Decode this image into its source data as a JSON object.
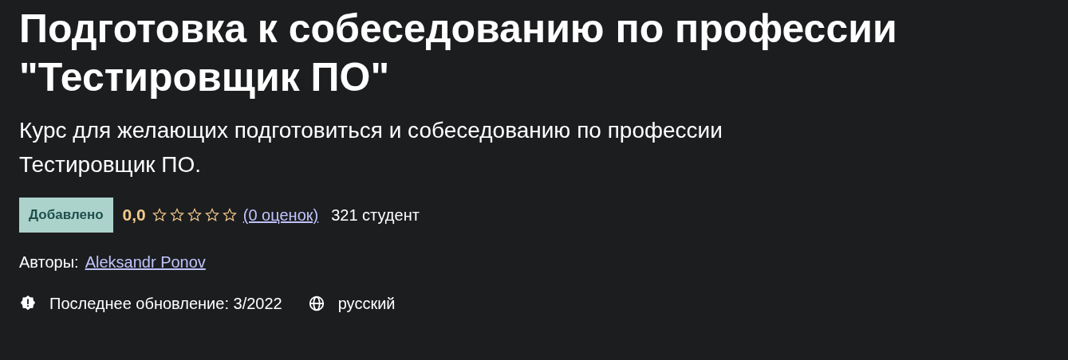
{
  "title": "Подготовка к собеседованию по профессии \"Тестировщик ПО\"",
  "subtitle": "Курс для желающих подготовиться и собеседованию по профессии Тестировщик ПО.",
  "badge": "Добавлено",
  "rating": {
    "value": "0,0",
    "stars": 0,
    "count_link": "(0 оценок)"
  },
  "students": "321 студент",
  "authors": {
    "label": "Авторы:",
    "name": "Aleksandr Ponov"
  },
  "meta": [
    {
      "kind": "alert",
      "text": "Последнее обновление: 3/2022"
    },
    {
      "kind": "globe",
      "text": "русский"
    }
  ]
}
